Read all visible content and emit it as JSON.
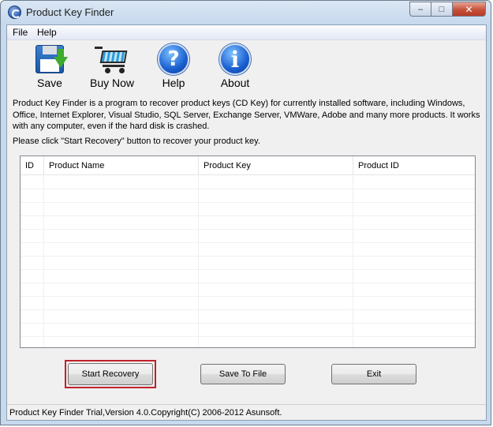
{
  "window": {
    "title": "Product Key Finder",
    "controls": {
      "minimize": "‒",
      "maximize": "□",
      "close": "✕"
    }
  },
  "menu": {
    "items": [
      "File",
      "Help"
    ]
  },
  "toolbar": {
    "save_label": "Save",
    "buy_label": "Buy Now",
    "help_label": "Help",
    "about_label": "About",
    "help_glyph": "?",
    "about_glyph": "i"
  },
  "description": "Product Key Finder is a program to recover product keys (CD Key) for currently installed software, including Windows, Office, Internet Explorer, Visual Studio, SQL Server, Exchange Server, VMWare, Adobe and many more products. It works with any computer, even if the hard disk is crashed.",
  "prompt": "Please click \"Start Recovery\" button to recover your product key.",
  "table": {
    "columns": [
      "ID",
      "Product Name",
      "Product Key",
      "Product ID"
    ],
    "rows": []
  },
  "buttons": {
    "start_recovery": "Start Recovery",
    "save_to_file": "Save To File",
    "exit": "Exit"
  },
  "status": "Product Key Finder Trial,Version 4.0.Copyright(C) 2006-2012 Asunsoft.",
  "colors": {
    "highlight_border": "#c0202a",
    "window_frame": "#c7d9ed",
    "close_button": "#c6523c"
  }
}
